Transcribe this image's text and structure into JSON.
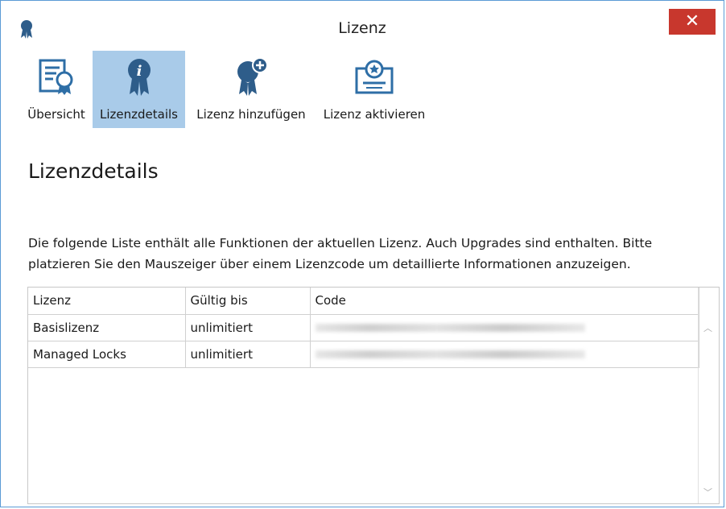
{
  "window": {
    "title": "Lizenz",
    "close_label": "✕"
  },
  "toolbar": {
    "items": [
      {
        "label": "Übersicht",
        "icon": "certificate-overview-icon",
        "active": false
      },
      {
        "label": "Lizenzdetails",
        "icon": "license-info-icon",
        "active": true
      },
      {
        "label": "Lizenz hinzufügen",
        "icon": "license-add-icon",
        "active": false
      },
      {
        "label": "Lizenz aktivieren",
        "icon": "license-activate-icon",
        "active": false
      }
    ]
  },
  "main": {
    "heading": "Lizenzdetails",
    "description": "Die folgende Liste enthält alle Funktionen der aktuellen Lizenz. Auch Upgrades sind enthalten. Bitte platzieren Sie den Mauszeiger über einem Lizenzcode um detaillierte Informationen anzuzeigen."
  },
  "table": {
    "headers": [
      "Lizenz",
      "Gültig bis",
      "Code"
    ],
    "rows": [
      {
        "license": "Basislizenz",
        "valid_until": "unlimitiert",
        "code": ""
      },
      {
        "license": "Managed Locks",
        "valid_until": "unlimitiert",
        "code": ""
      }
    ]
  },
  "colors": {
    "accent": "#5b9bd5",
    "active_tab": "#a9cbe9",
    "close": "#c8372d"
  }
}
